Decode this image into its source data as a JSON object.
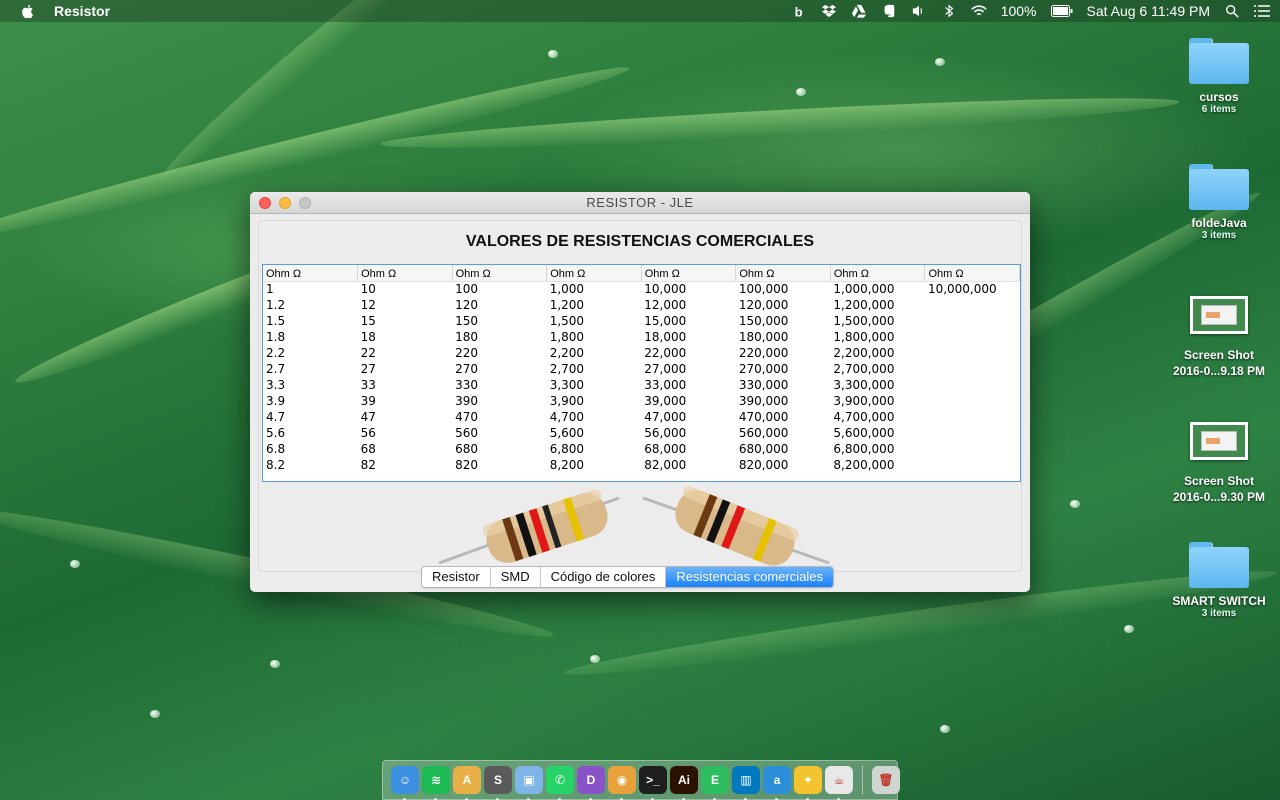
{
  "menubar": {
    "app_name": "Resistor",
    "battery": "100%",
    "datetime": "Sat Aug 6  11:49 PM",
    "status_icons": [
      "bitbucket-icon",
      "dropbox-icon",
      "google-drive-icon",
      "evernote-icon",
      "volume-icon",
      "bluetooth-icon",
      "wifi-icon",
      "battery-icon",
      "spotlight-icon",
      "notification-center-icon"
    ]
  },
  "desktop": {
    "items": [
      {
        "name": "cursos",
        "sub": "6 items",
        "kind": "folder"
      },
      {
        "name": "foldeJava",
        "sub": "3 items",
        "kind": "folder"
      },
      {
        "name": "Screen Shot",
        "sub": "2016-0...9.18 PM",
        "kind": "screenshot"
      },
      {
        "name": "Screen Shot",
        "sub": "2016-0...9.30 PM",
        "kind": "screenshot"
      },
      {
        "name": "SMART SWITCH",
        "sub": "3 items",
        "kind": "folder"
      }
    ]
  },
  "window": {
    "title": "RESISTOR - JLE",
    "heading": "VALORES DE RESISTENCIAS COMERCIALES",
    "table": {
      "headers": [
        "Ohm Ω",
        "Ohm Ω",
        "Ohm Ω",
        "Ohm Ω",
        "Ohm Ω",
        "Ohm Ω",
        "Ohm Ω",
        "Ohm Ω"
      ],
      "rows": [
        [
          "1",
          "10",
          "100",
          "1,000",
          "10,000",
          "100,000",
          "1,000,000",
          "10,000,000"
        ],
        [
          "1.2",
          "12",
          "120",
          "1,200",
          "12,000",
          "120,000",
          "1,200,000",
          ""
        ],
        [
          "1.5",
          "15",
          "150",
          "1,500",
          "15,000",
          "150,000",
          "1,500,000",
          ""
        ],
        [
          "1.8",
          "18",
          "180",
          "1,800",
          "18,000",
          "180,000",
          "1,800,000",
          ""
        ],
        [
          "2.2",
          "22",
          "220",
          "2,200",
          "22,000",
          "220,000",
          "2,200,000",
          ""
        ],
        [
          "2.7",
          "27",
          "270",
          "2,700",
          "27,000",
          "270,000",
          "2,700,000",
          ""
        ],
        [
          "3.3",
          "33",
          "330",
          "3,300",
          "33,000",
          "330,000",
          "3,300,000",
          ""
        ],
        [
          "3.9",
          "39",
          "390",
          "3,900",
          "39,000",
          "390,000",
          "3,900,000",
          ""
        ],
        [
          "4.7",
          "47",
          "470",
          "4,700",
          "47,000",
          "470,000",
          "4,700,000",
          ""
        ],
        [
          "5.6",
          "56",
          "560",
          "5,600",
          "56,000",
          "560,000",
          "5,600,000",
          ""
        ],
        [
          "6.8",
          "68",
          "680",
          "6,800",
          "68,000",
          "680,000",
          "6,800,000",
          ""
        ],
        [
          "8.2",
          "82",
          "820",
          "8,200",
          "82,000",
          "820,000",
          "8,200,000",
          ""
        ]
      ]
    },
    "tabs": [
      {
        "label": "Resistor",
        "active": false
      },
      {
        "label": "SMD",
        "active": false
      },
      {
        "label": "Código de colores",
        "active": false
      },
      {
        "label": "Resistencias comerciales",
        "active": true
      }
    ]
  },
  "dock": {
    "apps": [
      {
        "name": "finder-icon",
        "color": "#3d8fe0",
        "glyph": "☺"
      },
      {
        "name": "spotify-icon",
        "color": "#1db954",
        "glyph": "≋"
      },
      {
        "name": "android-studio-icon",
        "color": "#e8b046",
        "glyph": "A"
      },
      {
        "name": "sublime-text-icon",
        "color": "#5a5a5a",
        "glyph": "S"
      },
      {
        "name": "virtualbox-icon",
        "color": "#7fb5e6",
        "glyph": "▣"
      },
      {
        "name": "whatsapp-icon",
        "color": "#25d366",
        "glyph": "✆"
      },
      {
        "name": "app-d-icon",
        "color": "#8a52c8",
        "glyph": "D"
      },
      {
        "name": "chrome-icon",
        "color": "#e9a23b",
        "glyph": "◉"
      },
      {
        "name": "terminal-icon",
        "color": "#1e1e1e",
        "glyph": ">_"
      },
      {
        "name": "illustrator-icon",
        "color": "#2b1200",
        "glyph": "Ai"
      },
      {
        "name": "evernote-icon",
        "color": "#2dbe60",
        "glyph": "E"
      },
      {
        "name": "trello-icon",
        "color": "#0079bf",
        "glyph": "▥"
      },
      {
        "name": "app-a-icon",
        "color": "#2a8fd8",
        "glyph": "a"
      },
      {
        "name": "lightbulb-icon",
        "color": "#f4c430",
        "glyph": "✦"
      },
      {
        "name": "java-icon",
        "color": "#e8e8e8",
        "glyph": "☕"
      },
      {
        "name": "trash-icon",
        "color": "#cfd6d2",
        "glyph": "🗑"
      }
    ]
  }
}
